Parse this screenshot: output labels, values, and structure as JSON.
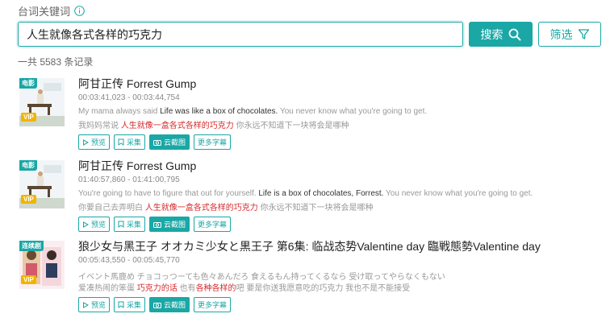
{
  "search": {
    "label": "台词关键词",
    "value": "人生就像各式各样的巧克力",
    "button_label": "搜索",
    "filter_label": "筛选",
    "count_text": "一共 5583 条记录"
  },
  "actions": {
    "preview": "预览",
    "collect": "采集",
    "screenshot": "云截图",
    "more": "更多字幕"
  },
  "results": [
    {
      "type": "电影",
      "vip": "VIP",
      "title": "阿甘正传 Forrest Gump",
      "time": "00:03:41,023 - 00:03:44,754",
      "en_before": "My mama always said  ",
      "en_hl": "Life was like a box of chocolates.",
      "en_after": " You never know what you're going to get.",
      "zh_before": "我妈妈常说  ",
      "zh_hl": "人生就像一盒各式各样的巧克力",
      "zh_after": "  你永远不知道下一块将会是哪种"
    },
    {
      "type": "电影",
      "vip": "VIP",
      "title": "阿甘正传 Forrest Gump",
      "time": "01:40:57,860 - 01:41:00,795",
      "en_before": "You're going to have to figure that out for yourself.  ",
      "en_hl": "Life is a box of chocolates, Forrest.",
      "en_after": " You never know what you're going to get.",
      "zh_before": "你要自己去弄明白  ",
      "zh_hl": "人生就像一盒各式各样的巧克力",
      "zh_after": "  你永远不知道下一块将会是哪种"
    },
    {
      "type": "连续剧",
      "vip": "VIP",
      "title": "狼少女与黑王子 オオカミ少女と黒王子 第6集: 临战态势Valentine day 臨戦態勢Valentine day",
      "time": "00:05:43,550 - 00:05:45,770",
      "en_before": "イベント馬鹿め      チョコっつーても色々あんだろ  食えるもん持ってくるなら    受け取ってやらなくもない",
      "en_hl": "",
      "en_after": "",
      "zh_before": "爱凑热闹的笨蛋  ",
      "zh_hl": "巧克力的话",
      "zh_mid": " 也有",
      "zh_hl2": "各种各样的",
      "zh_after": "吧 要是你送我愿意吃的巧克力 我也不是不能接受"
    }
  ],
  "colors": {
    "accent": "#1aa7a5",
    "highlight": "#d5282b",
    "vip": "#f0b400"
  }
}
